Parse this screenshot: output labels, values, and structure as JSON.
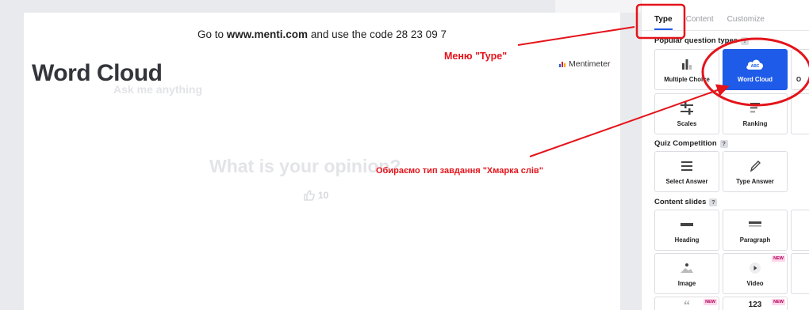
{
  "slide": {
    "instruction_prefix": "Go to ",
    "instruction_url": "www.menti.com",
    "instruction_suffix": " and use the code 28 23 09 7",
    "title": "Word Cloud",
    "subtitle": "Ask me anything",
    "question": "What is your opinion?",
    "likes": "10",
    "brand": "Mentimeter"
  },
  "annotations": {
    "type_menu": "Меню \"Type\"",
    "choose_type": "Обираємо тип завдання \"Хмарка слів\""
  },
  "panel": {
    "tabs": [
      "Type",
      "Content",
      "Customize"
    ],
    "active_tab": "Type",
    "sections": {
      "popular": "Popular question types",
      "quiz": "Quiz Competition",
      "content": "Content slides"
    },
    "help_glyph": "?",
    "popular_cards": [
      "Multiple Choice",
      "Word Cloud",
      "O",
      "Scales",
      "Ranking"
    ],
    "quiz_cards": [
      "Select Answer",
      "Type Answer"
    ],
    "content_cards": [
      "Heading",
      "Paragraph",
      "Image",
      "Video",
      "123"
    ],
    "new_badge": "NEW",
    "cloud_icon_text": "ABC"
  },
  "colors": {
    "accent": "#1d5be8",
    "annotation": "#e4141b",
    "background_gray": "#e9eaed"
  }
}
